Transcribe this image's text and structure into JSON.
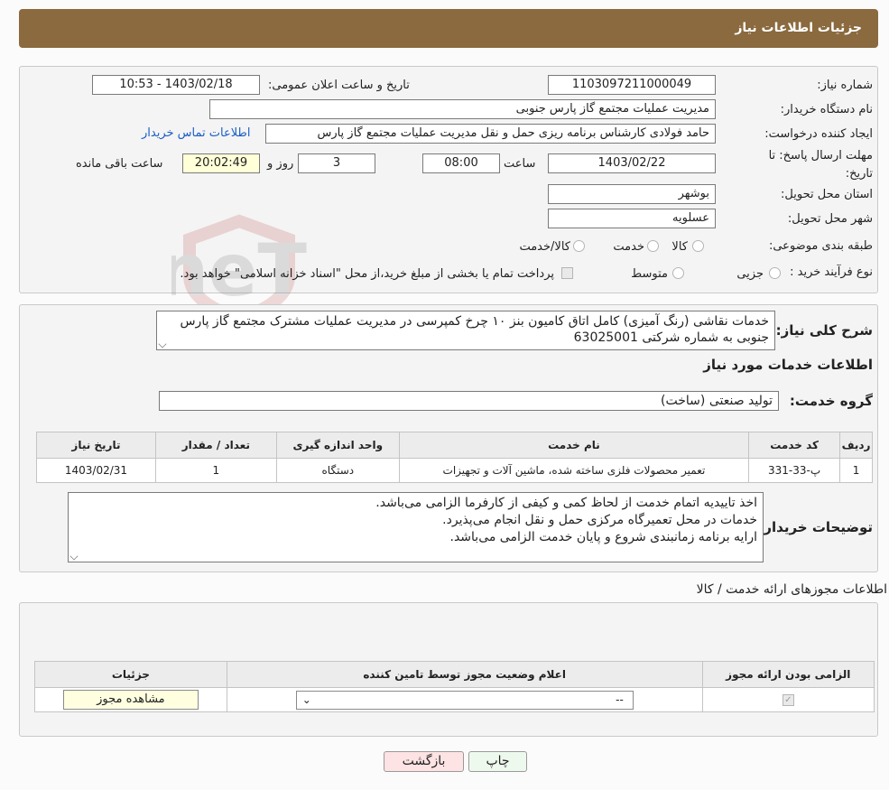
{
  "header": {
    "title": "جزئیات اطلاعات نیاز"
  },
  "form": {
    "need_number_label": "شماره نیاز:",
    "need_number": "1103097211000049",
    "announce_label": "تاریخ و ساعت اعلان عمومی:",
    "announce_value": "1403/02/18 - 10:53",
    "buyer_org_label": "نام دستگاه خریدار:",
    "buyer_org": "مدیریت عملیات مجتمع گاز پارس جنوبی",
    "creator_label": "ایجاد کننده درخواست:",
    "creator": "حامد فولادی کارشناس برنامه ریزی حمل و نقل مدیریت عملیات مجتمع گاز پارس",
    "contact_link": "اطلاعات تماس خریدار",
    "deadline_label": "مهلت ارسال پاسخ: تا تاریخ:",
    "deadline_date": "1403/02/22",
    "time_label": "ساعت",
    "deadline_time": "08:00",
    "days_value": "3",
    "days_label": "روز و",
    "remaining_time": "20:02:49",
    "remaining_label": "ساعت باقی مانده",
    "province_label": "استان محل تحویل:",
    "province": "بوشهر",
    "city_label": "شهر محل تحویل:",
    "city": "عسلویه",
    "category_label": "طبقه بندی موضوعی:",
    "category_options": [
      "کالا",
      "خدمت",
      "کالا/خدمت"
    ],
    "process_label": "نوع فرآیند خرید :",
    "process_options": [
      "جزیی",
      "متوسط"
    ],
    "payment_note": "پرداخت تمام یا بخشی از مبلغ خرید،از محل \"اسناد خزانه اسلامی\" خواهد بود."
  },
  "description": {
    "label": "شرح کلی نیاز:",
    "text": "خدمات نقاشی (رنگ آمیزی) کامل اتاق کامیون بنز ۱۰ چرخ کمپرسی در مدیریت عملیات مشترک مجتمع گاز پارس جنوبی به شماره شرکتی 63025001"
  },
  "services": {
    "section_title": "اطلاعات خدمات مورد نیاز",
    "group_label": "گروه خدمت:",
    "group_value": "تولید صنعتی (ساخت)",
    "table_headers": [
      "ردیف",
      "کد خدمت",
      "نام خدمت",
      "واحد اندازه گیری",
      "تعداد / مقدار",
      "تاریخ نیاز"
    ],
    "rows": [
      {
        "row": "1",
        "code": "پ-33-331",
        "name": "تعمیر محصولات فلزی ساخته شده، ماشین آلات و تجهیزات",
        "unit": "دستگاه",
        "qty": "1",
        "date": "1403/02/31"
      }
    ]
  },
  "buyer_notes": {
    "label": "توضیحات خریدار:",
    "lines": [
      "اخذ تاییدیه اتمام خدمت از لحاظ کمی و کیفی از کارفرما الزامی می‌باشد.",
      "خدمات در محل تعمیرگاه مرکزی حمل و نقل انجام می‌پذیرد.",
      "ارایه برنامه زمانبندی شروع و پایان خدمت الزامی می‌باشد."
    ]
  },
  "permits": {
    "section_title": "اطلاعات مجوزهای ارائه خدمت / کالا",
    "headers": [
      "الزامی بودن ارائه مجوز",
      "اعلام وضعیت مجوز توسط تامین کننده",
      "جزئیات"
    ],
    "select_value": "--",
    "view_button": "مشاهده مجوز"
  },
  "buttons": {
    "print": "چاپ",
    "back": "بازگشت"
  },
  "watermark": "AriaTender.neT"
}
